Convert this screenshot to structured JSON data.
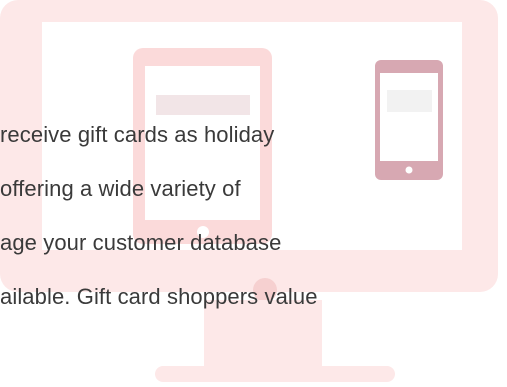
{
  "colors": {
    "monitor_pink": "#fde8e8",
    "tablet_pink": "#f9d7d7",
    "phone_mauve": "#d7a8b2",
    "screen_inner": "#ffffff",
    "text": "#3a3a3a"
  },
  "paragraph": {
    "lines": [
      "receive gift cards as holiday",
      "offering a wide variety of",
      "age your customer database",
      "ailable. Gift card shoppers value"
    ]
  }
}
